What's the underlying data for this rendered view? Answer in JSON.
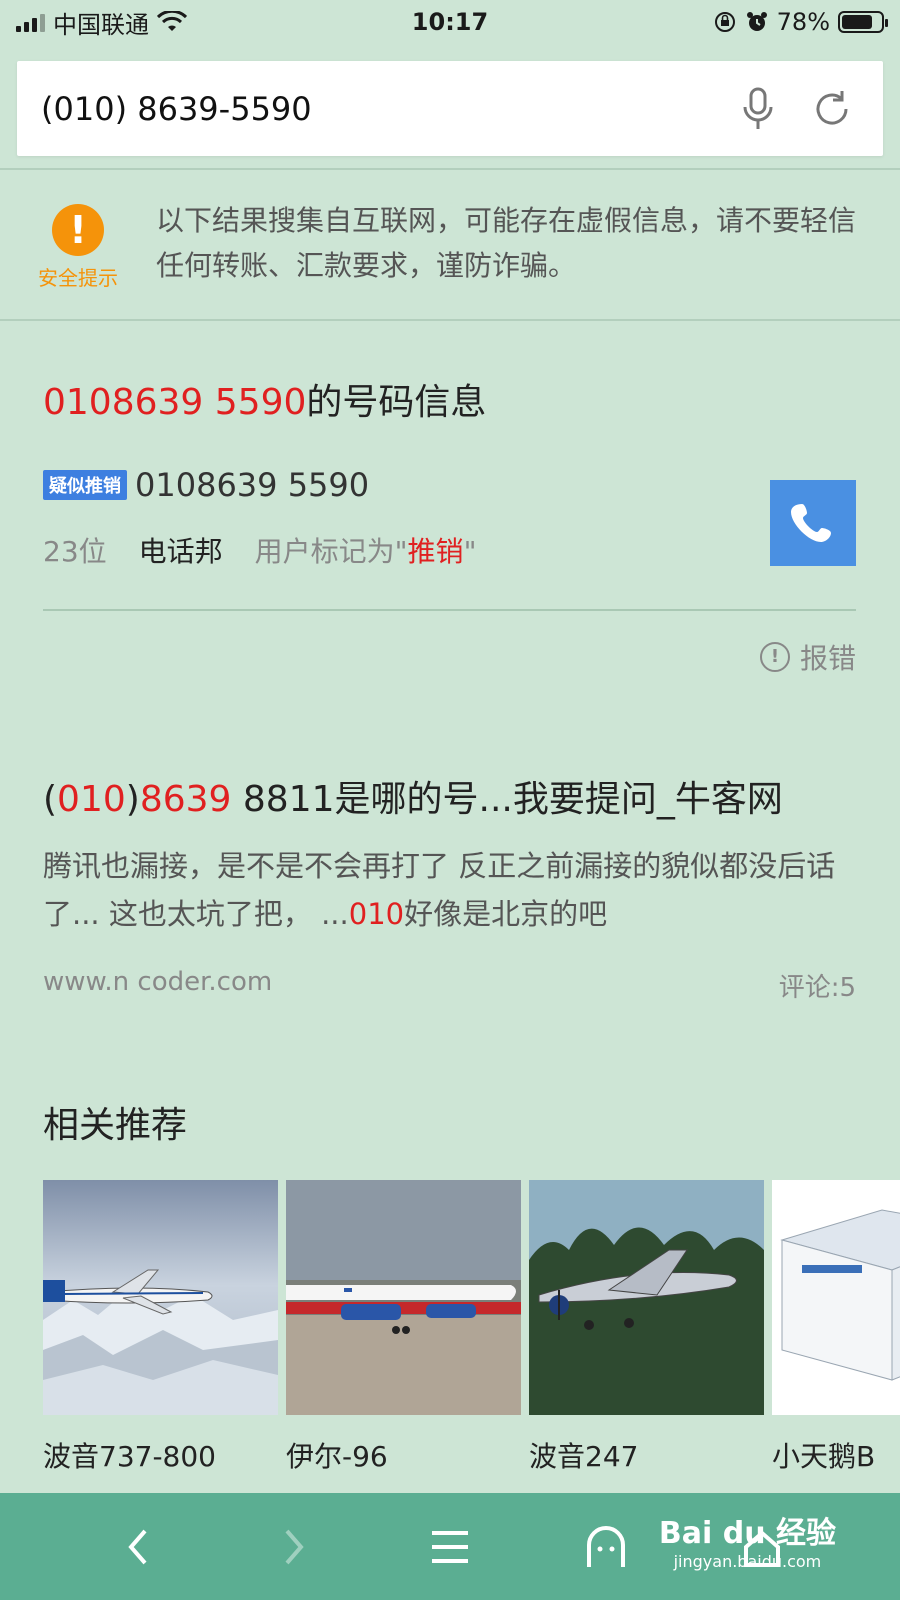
{
  "status_bar": {
    "carrier": "中国联通",
    "time": "10:17",
    "battery_percent": "78%",
    "battery_level": 0.78
  },
  "search": {
    "query": "(010) 8639-5590"
  },
  "notice": {
    "label": "安全提示",
    "text": "以下结果搜集自互联网，可能存在虚假信息，请不要轻信任何转账、汇款要求，谨防诈骗。"
  },
  "number_card": {
    "title_number": "0108639 5590",
    "title_suffix": "的号码信息",
    "tag": "疑似推销",
    "number": "0108639 5590",
    "digits": "23位",
    "source": "电话邦",
    "marked_prefix": "用户标记为\"",
    "marked_value": "推销",
    "marked_suffix": "\"",
    "report": "报错"
  },
  "result": {
    "title_p1": "(",
    "title_area": "010",
    "title_p2": ")",
    "title_num": "8639",
    "title_rest": " 8811是哪的号...我要提问_牛客网",
    "snippet_p1": "腾讯也漏接，是不是不会再打了 反正之前漏接的貌似都没后话了... 这也太坑了把，  ...",
    "snippet_hl": "010",
    "snippet_p2": "好像是北京的吧",
    "url": "www.n  coder.com",
    "comments": "评论:5"
  },
  "related": {
    "title": "相关推荐",
    "items": [
      {
        "label": "波音737-800"
      },
      {
        "label": "伊尔-96"
      },
      {
        "label": "波音247"
      },
      {
        "label": "小天鹅B"
      }
    ]
  },
  "watermark": {
    "main": "Bai du 经验",
    "sub": "jingyan.baidu.com"
  },
  "colors": {
    "background": "#cde5d5",
    "accent_red": "#e02020",
    "warning_orange": "#f5930a",
    "call_blue": "#4a90e2",
    "nav_green": "#5bae92"
  }
}
